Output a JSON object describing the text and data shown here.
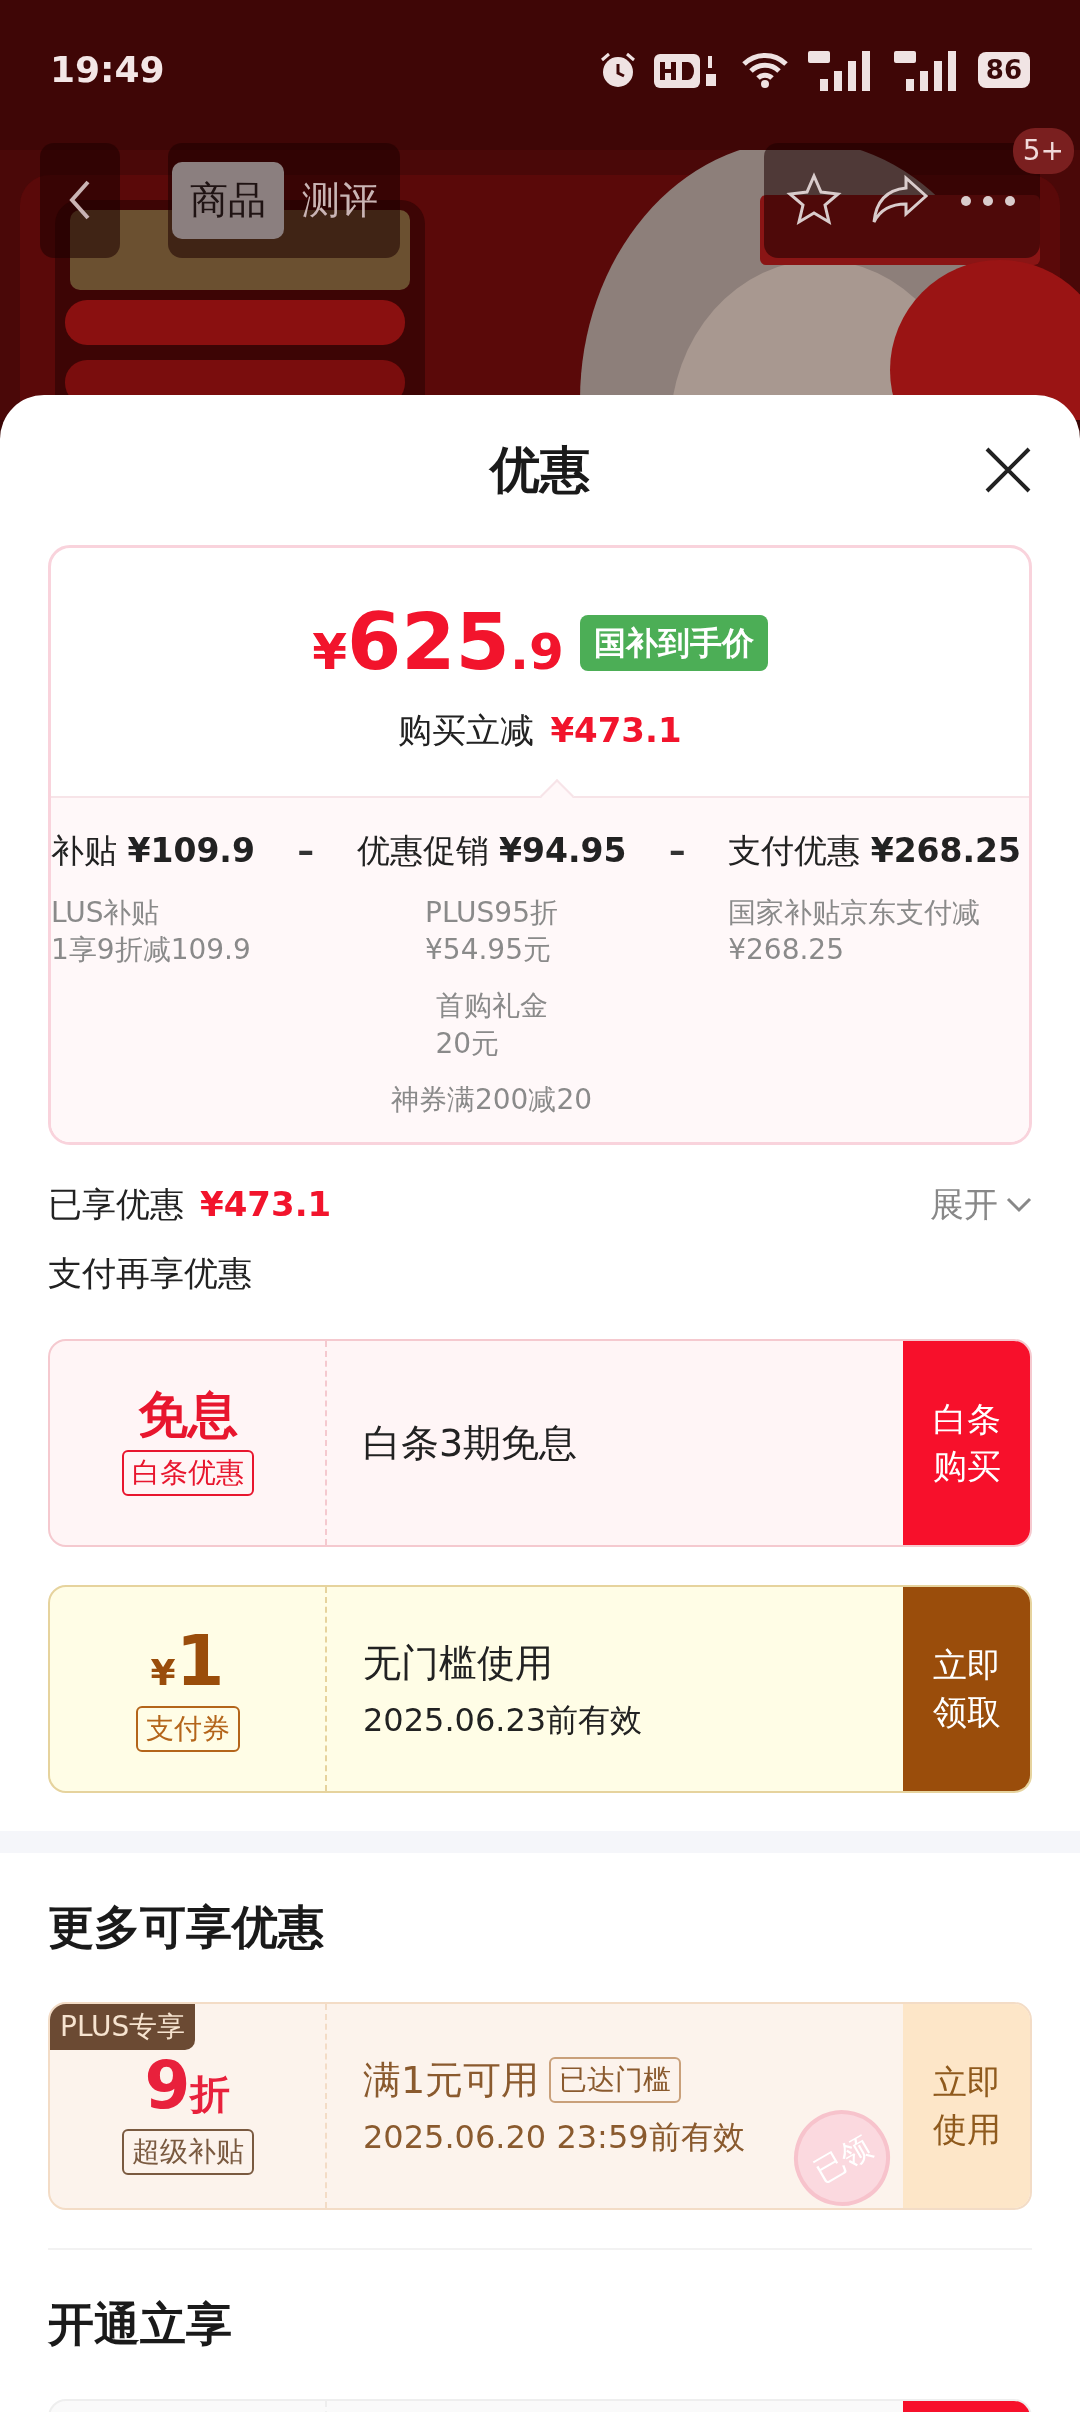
{
  "status_bar": {
    "time": "19:49",
    "battery": "86"
  },
  "header": {
    "tabs": [
      {
        "label": "商品",
        "selected": true
      },
      {
        "label": "测评",
        "selected": false
      }
    ],
    "badge": "5+"
  },
  "sheet": {
    "title": "优惠"
  },
  "price_card": {
    "currency": "¥",
    "price_main": "625",
    "price_decimal": ".9",
    "price_tag": "国补到手价",
    "discount_label": "购买立减",
    "discount_amount": "¥473.1",
    "breakdown": [
      {
        "label": "补贴",
        "amount": "¥109.9",
        "details": [
          {
            "lines": [
              "LUS补贴",
              "1享9折减109.9"
            ]
          }
        ]
      },
      {
        "label": "优惠促销",
        "amount": "¥94.95",
        "details": [
          {
            "lines": [
              "PLUS95折",
              "¥54.95元"
            ]
          },
          {
            "lines": [
              "首购礼金",
              "20元"
            ]
          },
          {
            "lines": [
              "神券满200减20"
            ]
          }
        ]
      },
      {
        "label": "支付优惠",
        "amount": "¥268.25",
        "details": [
          {
            "lines": [
              "国家补贴京东支付减",
              "¥268.25"
            ]
          }
        ]
      }
    ],
    "separators": [
      "–",
      "–"
    ]
  },
  "enjoyed": {
    "label": "已享优惠",
    "amount": "¥473.1",
    "toggle": "展开",
    "expanded": false
  },
  "pay_section": {
    "title": "支付再享优惠",
    "coupons": [
      {
        "kind": "baitiao",
        "value": "免息",
        "tag": "白条优惠",
        "title": "白条3期免息",
        "button": "白条购买"
      },
      {
        "kind": "voucher",
        "currency": "¥",
        "value": "1",
        "tag": "支付券",
        "title": "无门槛使用",
        "validity": "2025.06.23前有效",
        "button": "立即领取"
      }
    ]
  },
  "more_section": {
    "title": "更多可享优惠",
    "coupons": [
      {
        "kind": "plus",
        "corner_tag": "PLUS专享",
        "value": "9",
        "unit": "折",
        "tag": "超级补贴",
        "title": "满1元可用",
        "threshold_tag": "已达门槛",
        "validity": "2025.06.20 23:59前有效",
        "stamp": "已领",
        "button": "立即使用"
      }
    ]
  },
  "open_section": {
    "title": "开通立享",
    "coupons": [
      {
        "kind": "partial"
      }
    ]
  }
}
